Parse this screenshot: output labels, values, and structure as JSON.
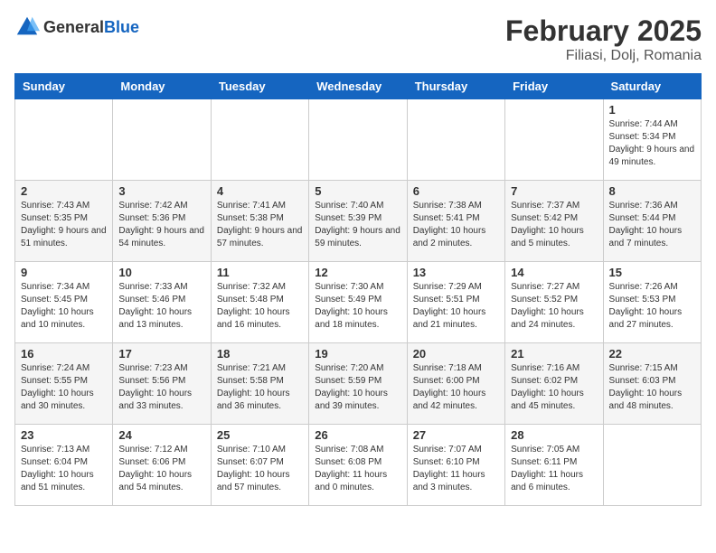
{
  "header": {
    "logo_general": "General",
    "logo_blue": "Blue",
    "month": "February 2025",
    "location": "Filiasi, Dolj, Romania"
  },
  "days_of_week": [
    "Sunday",
    "Monday",
    "Tuesday",
    "Wednesday",
    "Thursday",
    "Friday",
    "Saturday"
  ],
  "weeks": [
    [
      {
        "day": "",
        "info": ""
      },
      {
        "day": "",
        "info": ""
      },
      {
        "day": "",
        "info": ""
      },
      {
        "day": "",
        "info": ""
      },
      {
        "day": "",
        "info": ""
      },
      {
        "day": "",
        "info": ""
      },
      {
        "day": "1",
        "info": "Sunrise: 7:44 AM\nSunset: 5:34 PM\nDaylight: 9 hours and 49 minutes."
      }
    ],
    [
      {
        "day": "2",
        "info": "Sunrise: 7:43 AM\nSunset: 5:35 PM\nDaylight: 9 hours and 51 minutes."
      },
      {
        "day": "3",
        "info": "Sunrise: 7:42 AM\nSunset: 5:36 PM\nDaylight: 9 hours and 54 minutes."
      },
      {
        "day": "4",
        "info": "Sunrise: 7:41 AM\nSunset: 5:38 PM\nDaylight: 9 hours and 57 minutes."
      },
      {
        "day": "5",
        "info": "Sunrise: 7:40 AM\nSunset: 5:39 PM\nDaylight: 9 hours and 59 minutes."
      },
      {
        "day": "6",
        "info": "Sunrise: 7:38 AM\nSunset: 5:41 PM\nDaylight: 10 hours and 2 minutes."
      },
      {
        "day": "7",
        "info": "Sunrise: 7:37 AM\nSunset: 5:42 PM\nDaylight: 10 hours and 5 minutes."
      },
      {
        "day": "8",
        "info": "Sunrise: 7:36 AM\nSunset: 5:44 PM\nDaylight: 10 hours and 7 minutes."
      }
    ],
    [
      {
        "day": "9",
        "info": "Sunrise: 7:34 AM\nSunset: 5:45 PM\nDaylight: 10 hours and 10 minutes."
      },
      {
        "day": "10",
        "info": "Sunrise: 7:33 AM\nSunset: 5:46 PM\nDaylight: 10 hours and 13 minutes."
      },
      {
        "day": "11",
        "info": "Sunrise: 7:32 AM\nSunset: 5:48 PM\nDaylight: 10 hours and 16 minutes."
      },
      {
        "day": "12",
        "info": "Sunrise: 7:30 AM\nSunset: 5:49 PM\nDaylight: 10 hours and 18 minutes."
      },
      {
        "day": "13",
        "info": "Sunrise: 7:29 AM\nSunset: 5:51 PM\nDaylight: 10 hours and 21 minutes."
      },
      {
        "day": "14",
        "info": "Sunrise: 7:27 AM\nSunset: 5:52 PM\nDaylight: 10 hours and 24 minutes."
      },
      {
        "day": "15",
        "info": "Sunrise: 7:26 AM\nSunset: 5:53 PM\nDaylight: 10 hours and 27 minutes."
      }
    ],
    [
      {
        "day": "16",
        "info": "Sunrise: 7:24 AM\nSunset: 5:55 PM\nDaylight: 10 hours and 30 minutes."
      },
      {
        "day": "17",
        "info": "Sunrise: 7:23 AM\nSunset: 5:56 PM\nDaylight: 10 hours and 33 minutes."
      },
      {
        "day": "18",
        "info": "Sunrise: 7:21 AM\nSunset: 5:58 PM\nDaylight: 10 hours and 36 minutes."
      },
      {
        "day": "19",
        "info": "Sunrise: 7:20 AM\nSunset: 5:59 PM\nDaylight: 10 hours and 39 minutes."
      },
      {
        "day": "20",
        "info": "Sunrise: 7:18 AM\nSunset: 6:00 PM\nDaylight: 10 hours and 42 minutes."
      },
      {
        "day": "21",
        "info": "Sunrise: 7:16 AM\nSunset: 6:02 PM\nDaylight: 10 hours and 45 minutes."
      },
      {
        "day": "22",
        "info": "Sunrise: 7:15 AM\nSunset: 6:03 PM\nDaylight: 10 hours and 48 minutes."
      }
    ],
    [
      {
        "day": "23",
        "info": "Sunrise: 7:13 AM\nSunset: 6:04 PM\nDaylight: 10 hours and 51 minutes."
      },
      {
        "day": "24",
        "info": "Sunrise: 7:12 AM\nSunset: 6:06 PM\nDaylight: 10 hours and 54 minutes."
      },
      {
        "day": "25",
        "info": "Sunrise: 7:10 AM\nSunset: 6:07 PM\nDaylight: 10 hours and 57 minutes."
      },
      {
        "day": "26",
        "info": "Sunrise: 7:08 AM\nSunset: 6:08 PM\nDaylight: 11 hours and 0 minutes."
      },
      {
        "day": "27",
        "info": "Sunrise: 7:07 AM\nSunset: 6:10 PM\nDaylight: 11 hours and 3 minutes."
      },
      {
        "day": "28",
        "info": "Sunrise: 7:05 AM\nSunset: 6:11 PM\nDaylight: 11 hours and 6 minutes."
      },
      {
        "day": "",
        "info": ""
      }
    ]
  ]
}
